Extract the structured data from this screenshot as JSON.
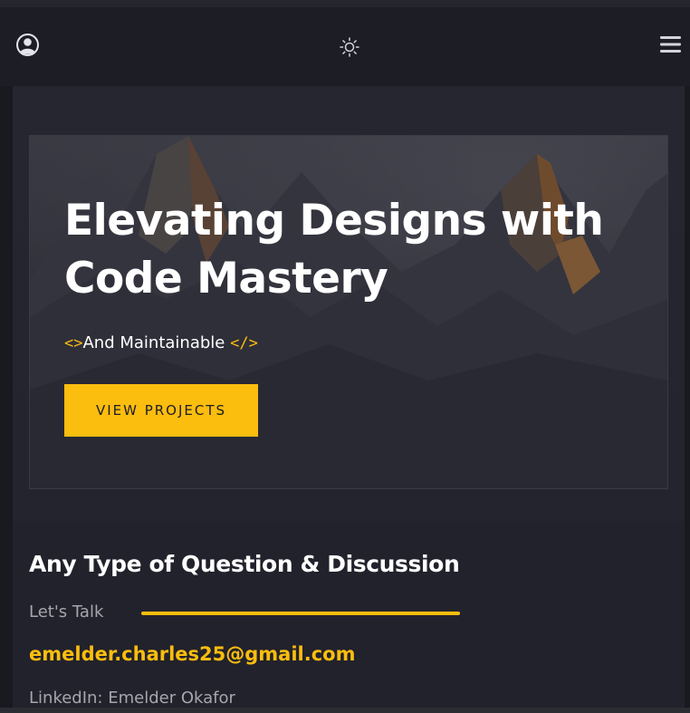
{
  "header": {
    "avatar_icon": "user-circle-icon",
    "theme_icon": "sun-icon",
    "menu_icon": "hamburger-menu-icon"
  },
  "hero": {
    "title": "Elevating Designs with Code Mastery",
    "subtitle_open_code": "<>",
    "subtitle_text": "And Maintainable",
    "subtitle_close_code": "</>",
    "cta_label": "VIEW PROJECTS",
    "background_image": "mountain-peaks-image"
  },
  "contact": {
    "title": "Any Type of Question & Discussion",
    "talk_label": "Let's Talk",
    "email": "emelder.charles25@gmail.com",
    "linkedin": "LinkedIn: Emelder Okafor"
  },
  "colors": {
    "accent": "#fbbd0e",
    "background": "#1f1f28",
    "header": "#1d1d26",
    "muted_text": "#a6a6ae"
  }
}
